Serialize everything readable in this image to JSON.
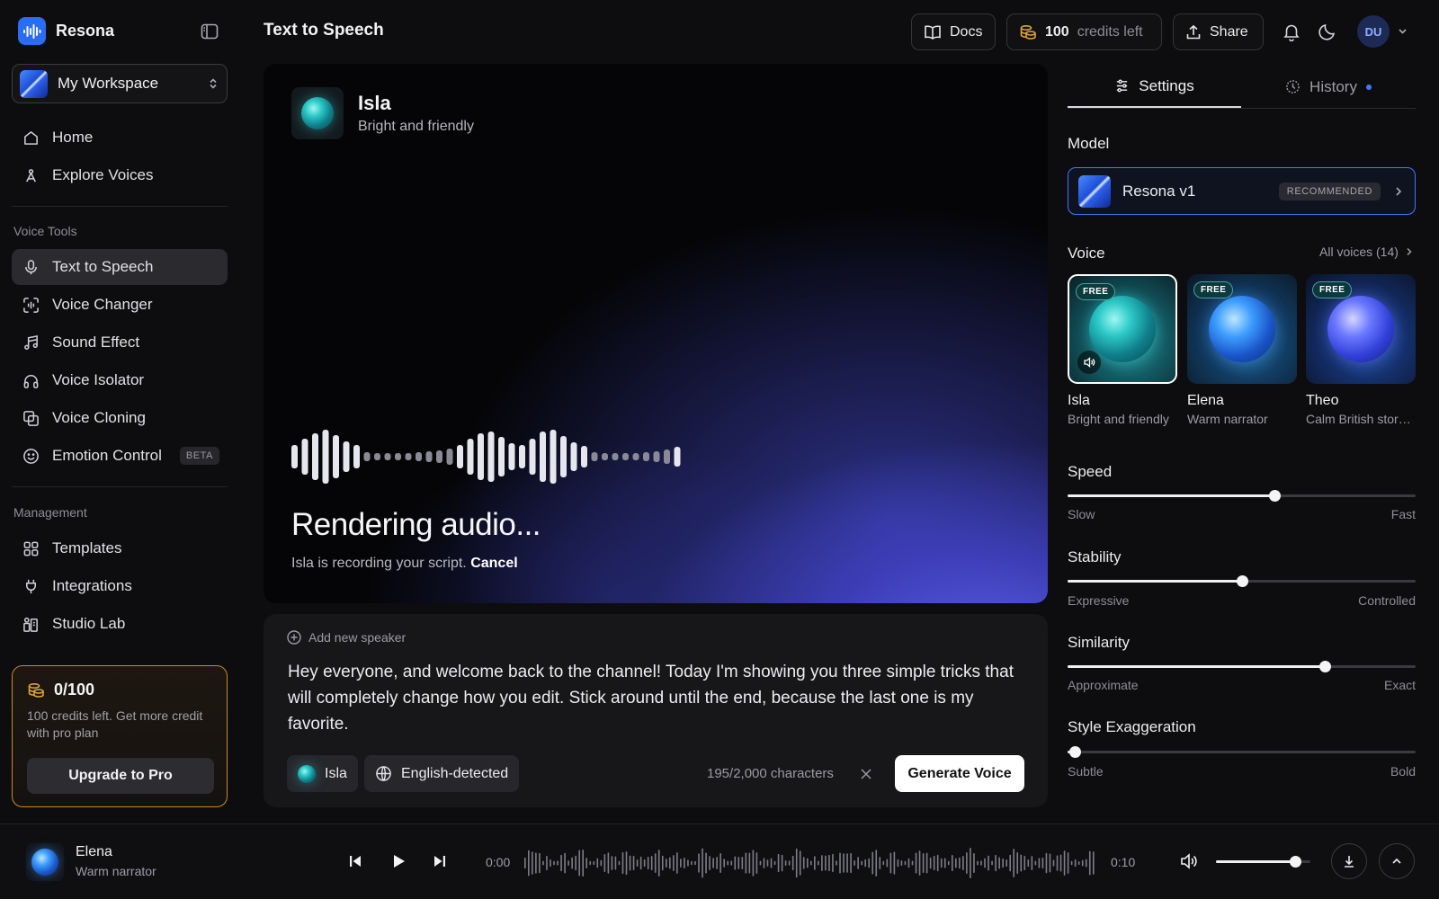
{
  "app": {
    "name": "Resona"
  },
  "workspace": {
    "name": "My Workspace"
  },
  "nav": {
    "primary": [
      {
        "label": "Home",
        "icon": "home-icon"
      },
      {
        "label": "Explore Voices",
        "icon": "explore-icon"
      }
    ],
    "voice_tools_title": "Voice Tools",
    "voice_tools": [
      {
        "label": "Text to Speech",
        "icon": "microphone-icon",
        "active": true
      },
      {
        "label": "Voice Changer",
        "icon": "voice-changer-icon"
      },
      {
        "label": "Sound Effect",
        "icon": "music-note-icon"
      },
      {
        "label": "Voice Isolator",
        "icon": "headphones-icon"
      },
      {
        "label": "Voice Cloning",
        "icon": "clone-icon"
      },
      {
        "label": "Emotion Control",
        "icon": "smile-icon",
        "badge": "BETA"
      }
    ],
    "management_title": "Management",
    "management": [
      {
        "label": "Templates",
        "icon": "grid-icon"
      },
      {
        "label": "Integrations",
        "icon": "plug-icon"
      },
      {
        "label": "Studio Lab",
        "icon": "studio-lab-icon"
      }
    ]
  },
  "credits_card": {
    "count": "0/100",
    "text": "100 credits left. Get more credit with pro plan",
    "button": "Upgrade to Pro",
    "accent": "#c98a28"
  },
  "topbar": {
    "title": "Text to Speech",
    "docs_label": "Docs",
    "credits_count": "100",
    "credits_label": "credits left",
    "share_label": "Share",
    "avatar_initials": "DU"
  },
  "stage": {
    "voice_name": "Isla",
    "voice_desc": "Bright and friendly",
    "status_title": "Rendering audio...",
    "status_text": "Isla is recording your script.",
    "cancel_label": "Cancel"
  },
  "editor": {
    "add_speaker": "Add new speaker",
    "script": "Hey everyone, and welcome back to the channel! Today I'm showing you three simple tricks that will completely change how you edit. Stick around until the end, because the last one is my favorite.",
    "voice_chip": "Isla",
    "language_chip": "English-detected",
    "char_count": "195/2,000 characters",
    "generate_label": "Generate Voice"
  },
  "panel": {
    "tab_settings": "Settings",
    "tab_history": "History",
    "model_title": "Model",
    "model_name": "Resona v1",
    "model_badge": "RECOMMENDED",
    "voice_title": "Voice",
    "all_voices": "All voices (14)",
    "voices": [
      {
        "name": "Isla",
        "desc": "Bright and friendly",
        "badge": "FREE",
        "selected": true
      },
      {
        "name": "Elena",
        "desc": "Warm narrator",
        "badge": "FREE"
      },
      {
        "name": "Theo",
        "desc": "Calm British storyteller",
        "badge": "FREE"
      }
    ],
    "sliders": [
      {
        "title": "Speed",
        "min_label": "Slow",
        "max_label": "Fast",
        "value": 0.595
      },
      {
        "title": "Stability",
        "min_label": "Expressive",
        "max_label": "Controlled",
        "value": 0.5
      },
      {
        "title": "Similarity",
        "min_label": "Approximate",
        "max_label": "Exact",
        "value": 0.74
      },
      {
        "title": "Style Exaggeration",
        "min_label": "Subtle",
        "max_label": "Bold",
        "value": 0.02
      }
    ]
  },
  "player": {
    "voice_name": "Elena",
    "voice_desc": "Warm narrator",
    "time_current": "0:00",
    "time_total": "0:10",
    "volume": 0.84
  },
  "colors": {
    "accent_blue": "#3e78ff",
    "orb_teal": "#2cc9c6",
    "orb_blue": "#3d7dff",
    "orb_indigo": "#5a5ef0"
  }
}
